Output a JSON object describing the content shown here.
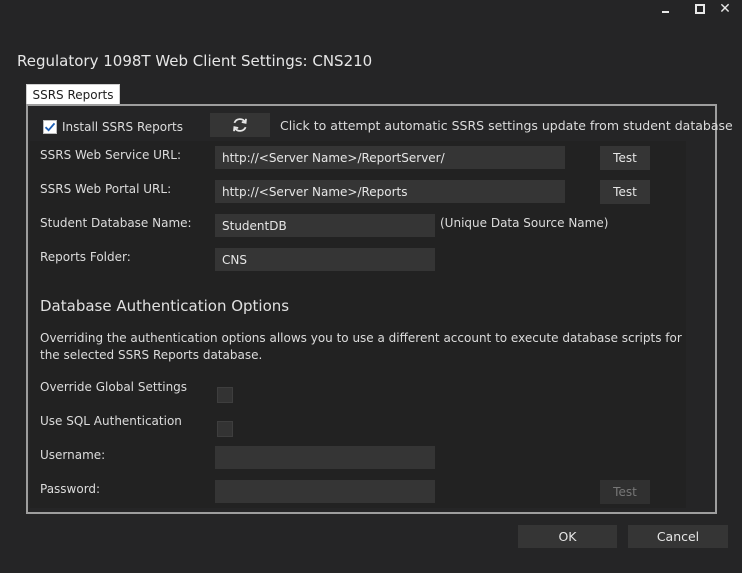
{
  "window": {
    "title": "Regulatory 1098T Web Client Settings: CNS210"
  },
  "tabs": [
    {
      "label": "SSRS Reports"
    }
  ],
  "ssrs": {
    "install_label": "Install SSRS Reports",
    "install_checked": true,
    "auto_update_hint": "Click to attempt automatic SSRS settings update from student database",
    "web_service_url_label": "SSRS Web Service URL:",
    "web_service_url_value": "http://<Server Name>/ReportServer/",
    "web_portal_url_label": "SSRS Web Portal URL:",
    "web_portal_url_value": "http://<Server Name>/Reports",
    "test_label": "Test",
    "student_db_label": "Student Database Name:",
    "student_db_value": "StudentDB",
    "student_db_hint": "(Unique Data Source Name)",
    "reports_folder_label": "Reports Folder:",
    "reports_folder_value": "CNS"
  },
  "auth": {
    "heading": "Database Authentication Options",
    "description": "Overriding the authentication options allows you to use a different account to execute database scripts for the selected SSRS Reports database.",
    "override_label": "Override Global Settings",
    "override_checked": false,
    "sql_auth_label": "Use SQL Authentication",
    "sql_auth_checked": false,
    "username_label": "Username:",
    "username_value": "",
    "password_label": "Password:",
    "password_value": "",
    "test_label": "Test"
  },
  "footer": {
    "ok_label": "OK",
    "cancel_label": "Cancel"
  }
}
